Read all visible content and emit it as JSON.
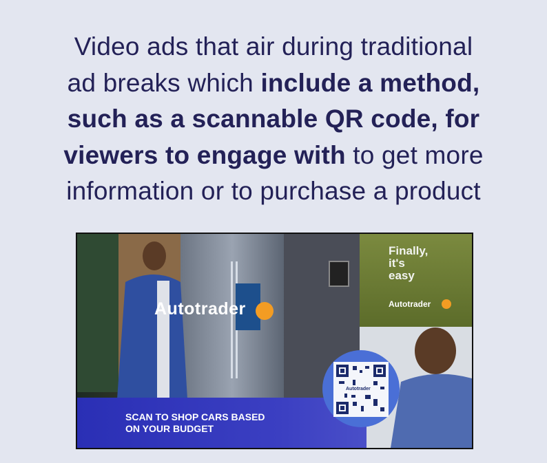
{
  "headline": {
    "line1": "Video ads that air during traditional",
    "line2_plain": "ad breaks which ",
    "line2_bold": "include a method,",
    "line3_bold": "such as a scannable QR code, for",
    "line4_bold": "viewers to engage with",
    "line4_plain": " to get more",
    "line5": "information or to purchase a product"
  },
  "ad": {
    "brand_left": "Autotrader",
    "tagline": [
      "Finally,",
      "it's",
      "easy"
    ],
    "brand_right": "Autotrader",
    "qr_brand": "Autotrader",
    "cta_line1": "SCAN TO SHOP CARS BASED",
    "cta_line2": "ON YOUR BUDGET"
  },
  "colors": {
    "headline_text": "#232157",
    "background": "#e3e6f0",
    "cta_banner": "#2b2fb8",
    "brand_accent": "#f39c23"
  }
}
